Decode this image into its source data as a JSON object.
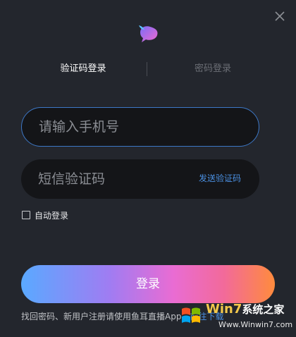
{
  "tabs": {
    "code_login": "验证码登录",
    "password_login": "密码登录"
  },
  "phone": {
    "placeholder": "请输入手机号",
    "value": ""
  },
  "sms": {
    "placeholder": "短信验证码",
    "value": "",
    "send_label": "发送验证码"
  },
  "auto_login": {
    "label": "自动登录",
    "checked": false
  },
  "login_button": {
    "label": "登录"
  },
  "footer": {
    "recover": "找回密码",
    "separator": "、",
    "new_user_text": "新用户注册请使用鱼耳直播App，",
    "download": "前往下载"
  },
  "watermark": {
    "brand": "Win7",
    "suffix": "系统之家",
    "site": "Www.Winwin7.com"
  },
  "colors": {
    "background": "#23262d",
    "field_bg": "#141518",
    "focus_border": "#3d78c7",
    "link": "#4a8fe0",
    "inactive_tab": "#6b6e75"
  },
  "icons": {
    "close": "close-icon",
    "logo": "fish-ear-logo-icon"
  }
}
